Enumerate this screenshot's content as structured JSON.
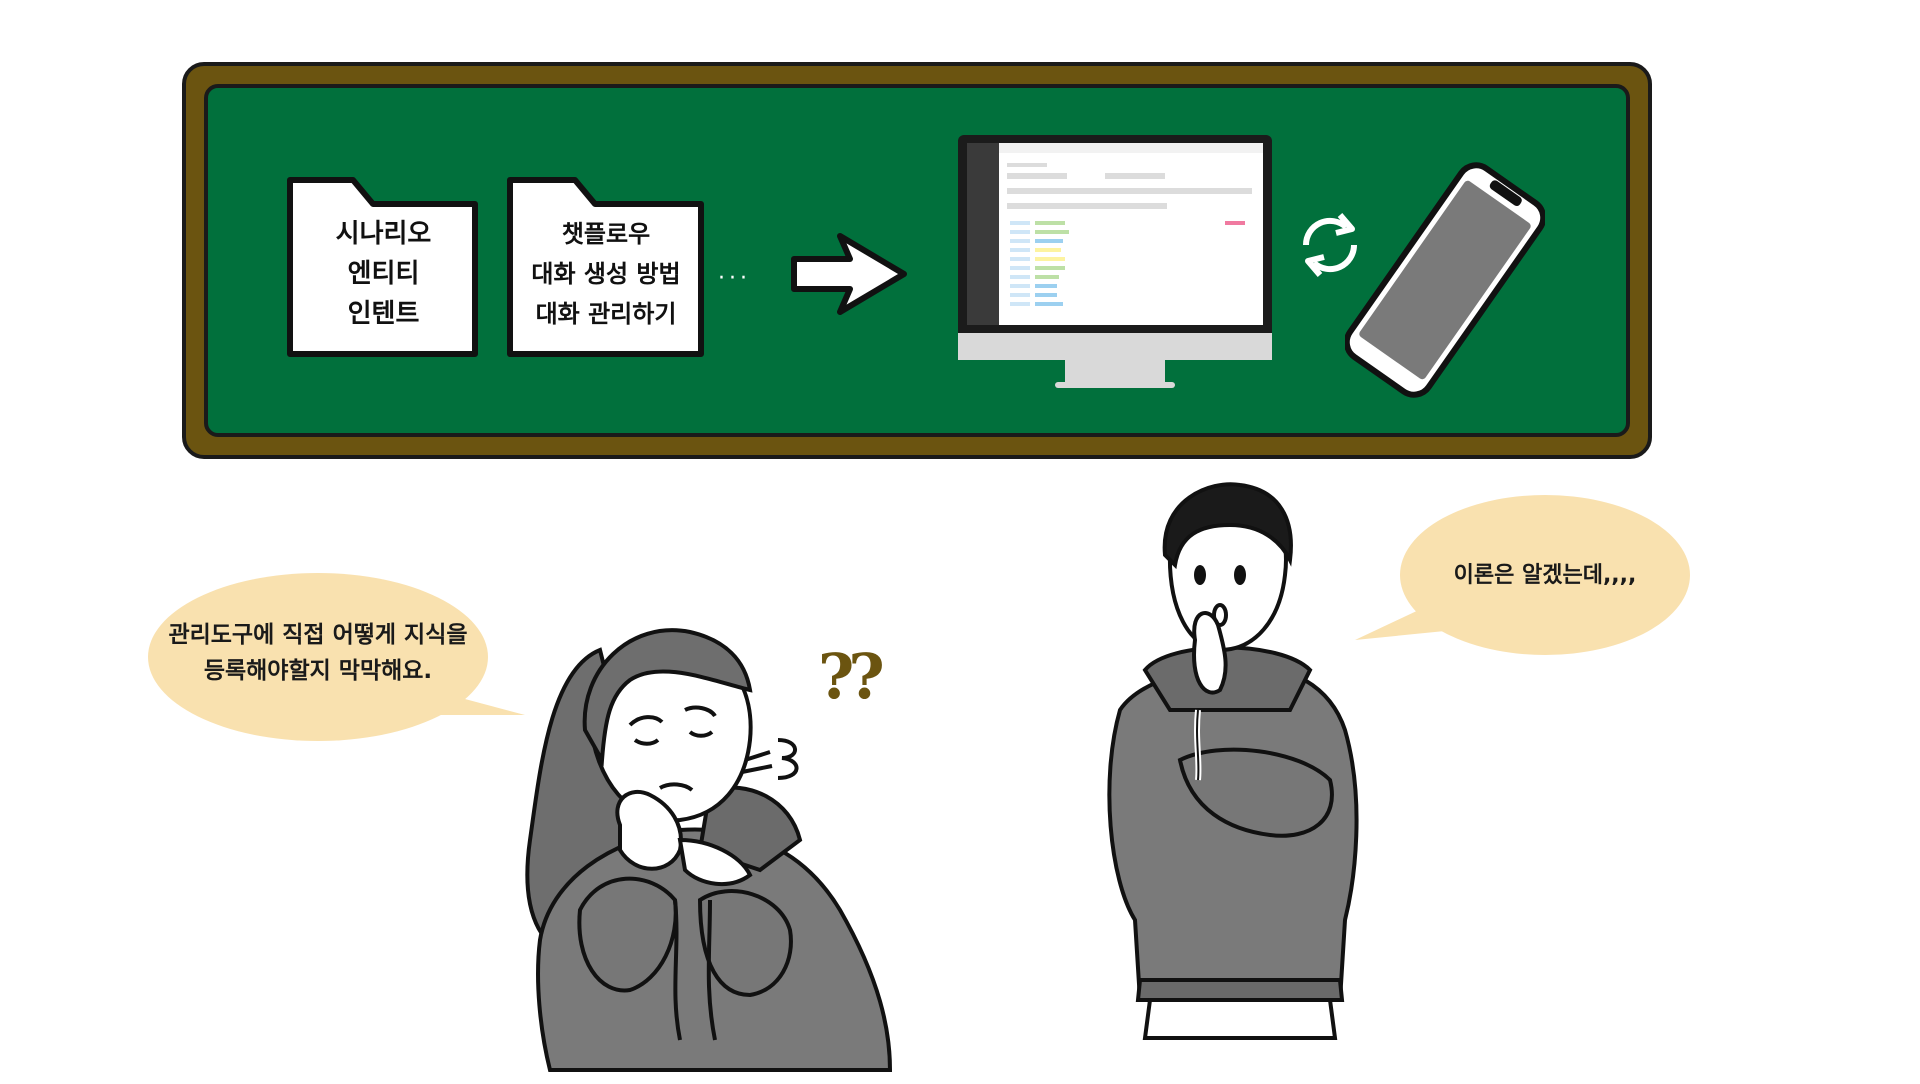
{
  "folders": [
    {
      "lines": [
        "시나리오",
        "엔티티",
        "인텐트"
      ]
    },
    {
      "lines": [
        "챗플로우",
        "대화 생성 방법",
        "대화 관리하기"
      ]
    }
  ],
  "continuation": "···",
  "bubbles": {
    "left": {
      "lines": [
        "관리도구에 직접 어떻게 지식을",
        "등록해야할지 막막해요."
      ]
    },
    "right": {
      "lines": [
        "이론은 알겠는데,,,,"
      ]
    }
  },
  "question_marks": "??",
  "colors": {
    "board_green": "#01703c",
    "frame_brown": "#6b5410",
    "bubble_fill": "#f9e1af",
    "hoodie_gray": "#7a7a7a"
  },
  "icons": [
    "folder-icon",
    "arrow-right-icon",
    "monitor-icon",
    "sync-icon",
    "smartphone-icon"
  ]
}
